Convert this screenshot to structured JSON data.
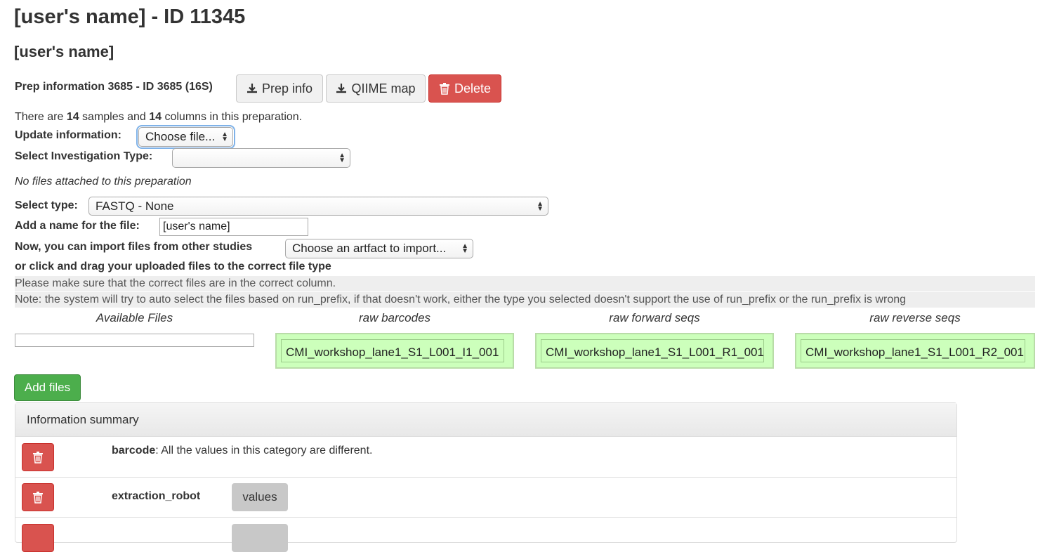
{
  "header": {
    "title": "[user's name] - ID 11345",
    "subtitle": "[user's name]"
  },
  "prep": {
    "label": "Prep information 3685 - ID 3685 (16S)",
    "prep_info_button": "Prep info",
    "qiime_map_button": "QIIME map",
    "delete_button": "Delete"
  },
  "summary_line": {
    "pre": "There are ",
    "samples_count": "14",
    "mid1": " samples and ",
    "columns_count": "14",
    "mid2": " columns in this preparation."
  },
  "update": {
    "label": "Update information:",
    "file_select_value": "Choose file..."
  },
  "investigation": {
    "label": "Select Investigation Type:",
    "value": ""
  },
  "no_files_text": "No files attached to this preparation",
  "select_type": {
    "label": "Select type:",
    "value": "FASTQ - None"
  },
  "file_name": {
    "label": "Add a name for the file:",
    "value": "[user's name]"
  },
  "import": {
    "label": "Now, you can import files from other studies",
    "select_value": "Choose an artfact to import..."
  },
  "drag_instruction": "or click and drag your uploaded files to the correct file type",
  "notes": {
    "line1": "Please make sure that the correct files are in the correct column.",
    "line2": "Note: the system will try to auto select the files based on run_prefix, if that doesn't work, either the type you selected doesn't support the use of run_prefix or the run_prefix is wrong"
  },
  "file_columns": {
    "available": "Available Files",
    "raw_barcodes": "raw barcodes",
    "raw_forward": "raw forward seqs",
    "raw_reverse": "raw reverse seqs",
    "barcodes_file": "CMI_workshop_lane1_S1_L001_I1_001",
    "forward_file": "CMI_workshop_lane1_S1_L001_R1_001",
    "reverse_file": "CMI_workshop_lane1_S1_L001_R2_001"
  },
  "add_files_button": "Add files",
  "info_summary": {
    "title": "Information summary",
    "rows": [
      {
        "name": "barcode",
        "desc": ": All the values in this category are different."
      },
      {
        "name": "extraction_robot",
        "badge": "values"
      }
    ]
  },
  "colors": {
    "danger": "#d9534f",
    "success": "#4cae4c",
    "dropzone": "#ccffbb"
  }
}
